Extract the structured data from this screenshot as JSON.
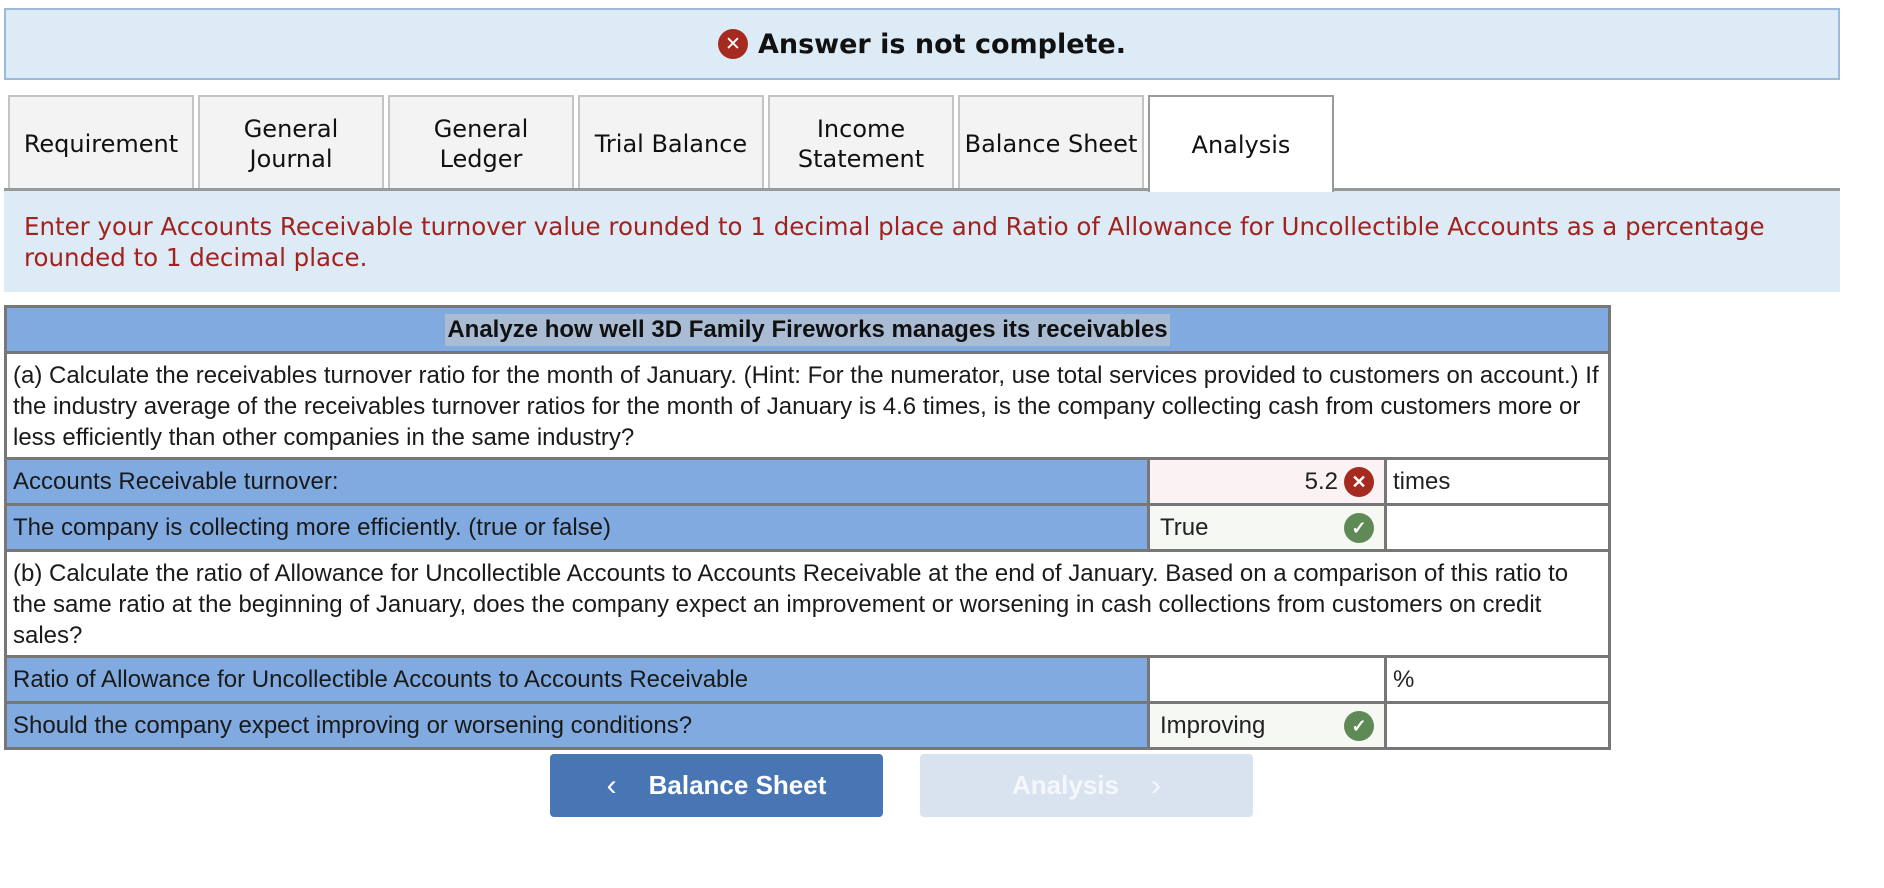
{
  "banner": {
    "icon": "x-circle-icon",
    "text": "Answer is not complete."
  },
  "tabs": [
    {
      "label": "Requirement",
      "active": false
    },
    {
      "label": "General\nJournal",
      "active": false
    },
    {
      "label": "General\nLedger",
      "active": false
    },
    {
      "label": "Trial Balance",
      "active": false
    },
    {
      "label": "Income\nStatement",
      "active": false
    },
    {
      "label": "Balance Sheet",
      "active": false
    },
    {
      "label": "Analysis",
      "active": true
    }
  ],
  "instructions": "Enter your Accounts Receivable turnover value rounded to 1 decimal place and Ratio of Allowance for Uncollectible Accounts as a percentage rounded to 1 decimal place.",
  "table": {
    "title": "Analyze how well 3D Family Fireworks manages its receivables",
    "part_a": {
      "question": "(a) Calculate the receivables turnover ratio for the month of January. (Hint: For the numerator, use total services provided to customers on account.) If the industry average of the receivables turnover ratios for the month of January is 4.6 times, is the company collecting cash from customers more or less efficiently than other companies in the same industry?",
      "rows": [
        {
          "label": "Accounts Receivable turnover:",
          "value": "5.2",
          "status": "incorrect",
          "unit": "times"
        },
        {
          "label": "The company is collecting more efficiently. (true or false)",
          "value": "True",
          "status": "correct",
          "unit": ""
        }
      ]
    },
    "part_b": {
      "question": "(b) Calculate the ratio of Allowance for Uncollectible Accounts to Accounts Receivable at the end of January. Based on a comparison of this ratio to the same ratio at the beginning of January, does the company expect an improvement or worsening in cash collections from customers on credit sales?",
      "rows": [
        {
          "label": "Ratio of Allowance for Uncollectible Accounts to Accounts Receivable",
          "value": "",
          "status": "empty",
          "unit": "%"
        },
        {
          "label": "Should the company expect improving or worsening conditions?",
          "value": "Improving",
          "status": "correct",
          "unit": ""
        }
      ]
    }
  },
  "nav": {
    "prev_label": "Balance Sheet",
    "prev_icon": "chevron-left-icon",
    "next_label": "Analysis",
    "next_icon": "chevron-right-icon",
    "next_disabled": true
  },
  "colors": {
    "banner_bg": "#ddebf7",
    "error_red": "#a52a1f",
    "success_green": "#5f8a56",
    "instruction_text": "#a3221d",
    "table_header_blue": "#80aae0",
    "button_blue": "#4876b4",
    "button_disabled": "#d9e3f0"
  }
}
